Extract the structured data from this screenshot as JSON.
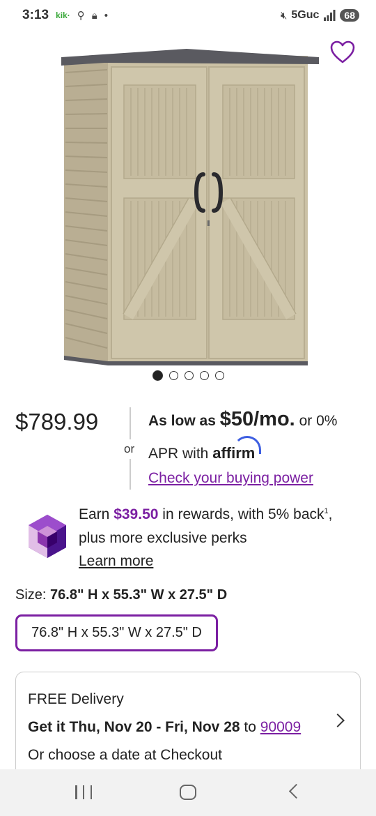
{
  "status_bar": {
    "time": "3:13",
    "kik": "kik·",
    "network": "5Guc",
    "battery": "68",
    "icons": [
      "key-icon",
      "lock-icon",
      "dot-icon",
      "mute-icon",
      "signal-icon",
      "battery-icon"
    ]
  },
  "product": {
    "image_alt": "Vertical resin storage shed",
    "carousel": {
      "count": 5,
      "active_index": 0
    },
    "favorite_icon": "heart-outline-icon"
  },
  "price": {
    "amount": "$789.99",
    "or_label": "or",
    "financing_prefix": "As low as",
    "financing_amount": "$50/mo.",
    "financing_suffix": "or 0%",
    "financing_line2": "APR with",
    "provider": "affirm",
    "buying_power_link": "Check your buying power"
  },
  "rewards": {
    "earn": "Earn",
    "amount": "$39.50",
    "suffix": "in rewards, with 5% back",
    "footnote": "1",
    "comma": ",",
    "line2": "plus more exclusive perks",
    "learn_more": "Learn more",
    "icon": "gem-icon"
  },
  "size": {
    "label": "Size:",
    "selected": "76.8\" H x 55.3\" W x 27.5\" D",
    "option": "76.8\" H x 55.3\" W x 27.5\" D"
  },
  "delivery": {
    "title": "FREE Delivery",
    "date_text": "Get it Thu, Nov 20 - Fri, Nov 28",
    "to": "to",
    "zip": "90009",
    "line3": "Or choose a date at Checkout"
  },
  "colors": {
    "accent": "#7b1fa2",
    "affirm_blue": "#3d5ee1",
    "shed_body": "#c9bfa3",
    "shed_roof": "#5a5a60"
  }
}
